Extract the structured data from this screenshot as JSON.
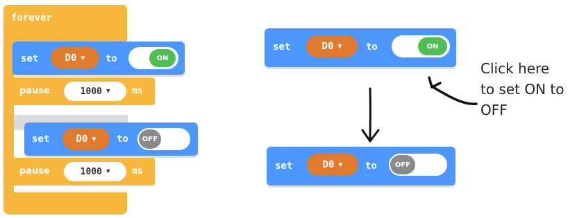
{
  "forever": {
    "label": "forever"
  },
  "left_program": {
    "set_on": {
      "set_label": "set",
      "pin": "D0",
      "to_label": "to",
      "state": "ON"
    },
    "pause1": {
      "label": "pause",
      "value": "1000",
      "unit": "ms"
    },
    "set_off": {
      "set_label": "set",
      "pin": "D0",
      "to_label": "to",
      "state": "OFF"
    },
    "pause2": {
      "label": "pause",
      "value": "1000",
      "unit": "ms"
    }
  },
  "right_examples": {
    "before": {
      "set_label": "set",
      "pin": "D0",
      "to_label": "to",
      "state": "ON"
    },
    "after": {
      "set_label": "set",
      "pin": "D0",
      "to_label": "to",
      "state": "OFF"
    }
  },
  "annotation": {
    "line1": "Click here",
    "line2": "to set ON to",
    "line3": "OFF"
  },
  "colors": {
    "event_orange": "#f6b73c",
    "pins_blue": "#4c97ff",
    "pin_brown": "#e07a2d",
    "on_green": "#4fbe54",
    "off_gray": "#8a8a8a"
  },
  "icons": {
    "dropdown": "caret-down-icon",
    "arrow": "hand-drawn-arrow-icon"
  }
}
